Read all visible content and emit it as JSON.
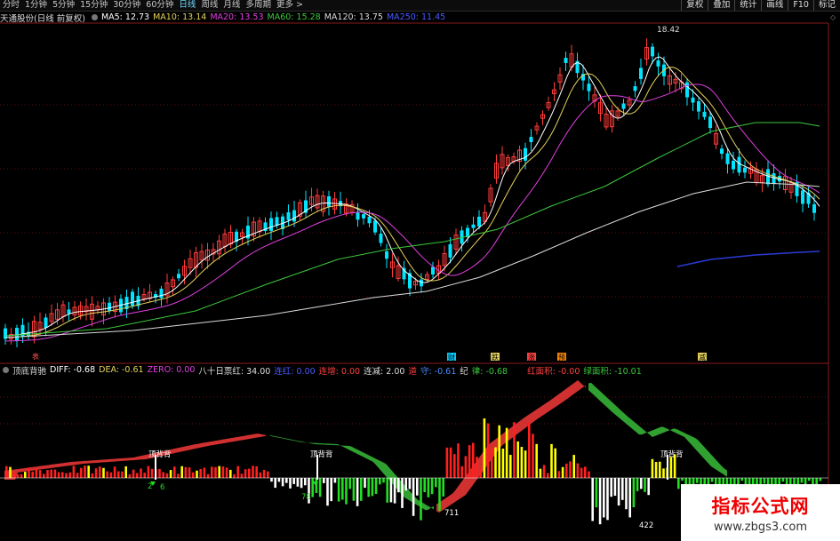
{
  "toolbar": {
    "items": [
      "分时",
      "1分钟",
      "5分钟",
      "15分钟",
      "30分钟",
      "60分钟",
      "日线",
      "周线",
      "月线",
      "多周期",
      "更多 >"
    ],
    "active": "日线",
    "right_items": [
      "复权",
      "叠加",
      "统计",
      "画线",
      "F10",
      "标记"
    ]
  },
  "main_legend": {
    "stock": "天通股份(日线 前复权)",
    "ma5": "MA5: 12.73",
    "ma10": "MA10: 13.14",
    "ma20": "MA20: 13.53",
    "ma60": "MA60: 15.28",
    "ma120": "MA120: 13.75",
    "ma250": "MA250: 11.45"
  },
  "main_chart": {
    "high_label": "18.42",
    "event_markers": [
      "财",
      "跌",
      "涨",
      "预",
      "减"
    ],
    "left_marker": "表"
  },
  "sub_legend": {
    "name": "顶底背驰",
    "diff": "DIFF: -0.68",
    "dea": "DEA: -0.61",
    "zero": "ZERO: 0.00",
    "days80": "八十日票红: 34.00",
    "lianhong": "连红: 0.00",
    "lianzeng": "连增: 0.00",
    "lianjian": "连减: 2.00",
    "dao": "道",
    "shou": "守: -0.61",
    "ji": "纪",
    "lv": "律: -0.68",
    "hongmianji": "红面积: -0.00",
    "lvmianji": "绿面积: -10.01"
  },
  "sub_chart": {
    "labels": [
      "顶背背",
      "顶背背",
      "顶背背"
    ],
    "numbers": [
      "2",
      "6",
      "78",
      "711",
      "422"
    ]
  },
  "watermark": {
    "title": "指标公式网",
    "url": "www.zbgs3.com"
  },
  "colors": {
    "ma5": "#ffffff",
    "ma10": "#e6d25a",
    "ma20": "#e040e0",
    "ma60": "#3cc83c",
    "ma120": "#dcdcdc",
    "ma250": "#2a3bd6",
    "up": "#ff3b3b",
    "down": "#00e5ff"
  }
}
